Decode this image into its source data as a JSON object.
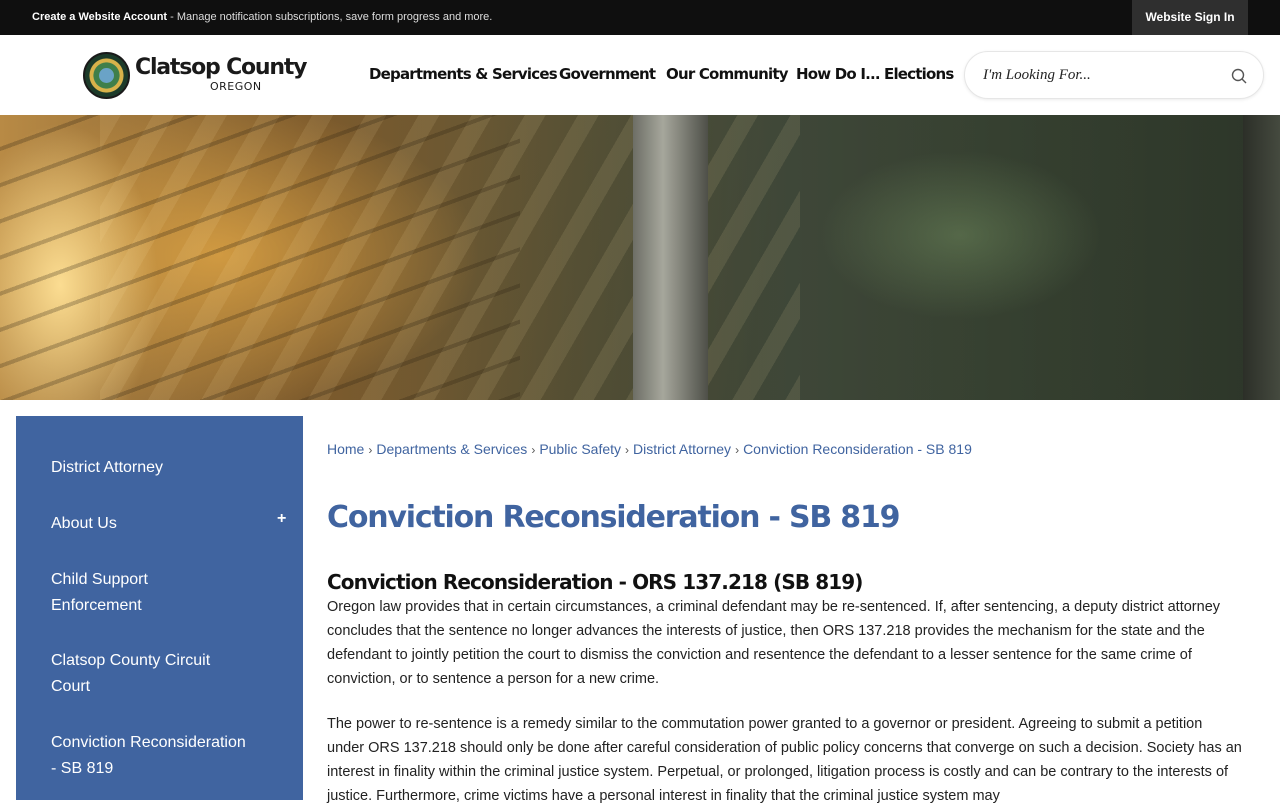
{
  "topbar": {
    "create_account": "Create a Website Account",
    "message": " - Manage notification subscriptions, save form progress and more.",
    "sign_in": "Website Sign In"
  },
  "header": {
    "logo_name": "Clatsop County",
    "logo_sub": "OREGON",
    "nav": [
      {
        "label": "Departments & Services"
      },
      {
        "label": "Government"
      },
      {
        "label": "Our Community"
      },
      {
        "label": "How Do I..."
      },
      {
        "label": "Elections"
      }
    ],
    "search_placeholder": "I'm Looking For..."
  },
  "sidebar": {
    "items": [
      {
        "label": "District Attorney"
      },
      {
        "label": "About Us"
      },
      {
        "label": "Child Support Enforcement"
      },
      {
        "label": "Clatsop County Circuit Court"
      },
      {
        "label": "Conviction Reconsideration - SB 819"
      }
    ],
    "toggle": "+"
  },
  "breadcrumb": [
    {
      "label": "Home"
    },
    {
      "label": "Departments & Services"
    },
    {
      "label": "Public Safety"
    },
    {
      "label": "District Attorney"
    },
    {
      "label": "Conviction Reconsideration - SB 819"
    }
  ],
  "breadcrumb_sep": "›",
  "main": {
    "title": "Conviction Reconsideration - SB 819",
    "section_title": "Conviction Reconsideration - ORS 137.218 (SB 819)",
    "paragraphs": [
      "Oregon law provides that in certain circumstances, a criminal defendant may be re-sentenced. If, after sentencing, a deputy district attorney concludes that the sentence no longer advances the interests of justice, then ORS 137.218 provides the mechanism for the state and the defendant to jointly petition the court to dismiss the conviction and resentence the defendant to a lesser sentence for the same crime of conviction, or to sentence a person for a new crime.",
      "The power to re-sentence is a remedy similar to the commutation power granted to a governor or president. Agreeing to submit a petition under ORS 137.218 should only be done after careful consideration of public policy concerns that converge on such a decision. Society has an interest in finality within the criminal justice system. Perpetual, or prolonged, litigation process is costly and can be contrary to the interests of justice. Furthermore, crime victims have a personal interest in finality that the criminal justice system may"
    ]
  }
}
